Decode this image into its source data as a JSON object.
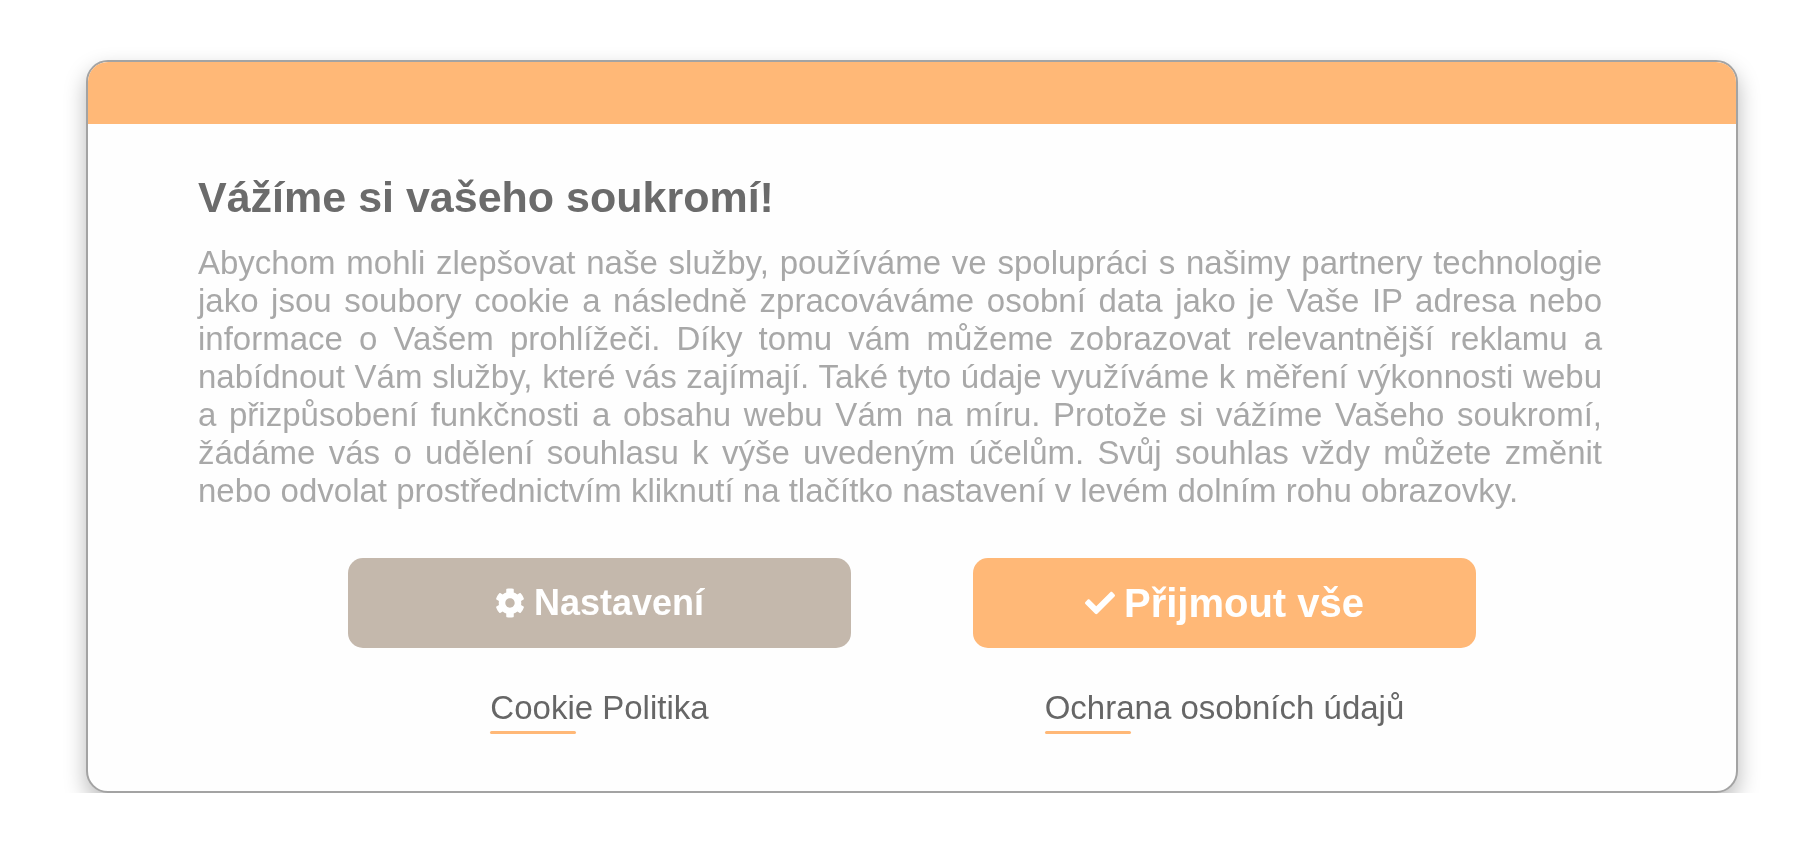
{
  "dialog": {
    "title": "Vážíme si vašeho soukromí!",
    "body": "Abychom mohli zlepšovat naše služby, používáme ve spolupráci s našimy partnery technologie jako jsou soubory cookie a následně zpracováváme osobní data jako je Vaše IP adresa nebo informace o Vašem prohlížeči. Díky tomu vám můžeme zobrazovat relevantnější reklamu a nabídnout Vám služby, které vás zajímají. Také tyto údaje využíváme k měření výkonnosti webu a přizpůsobení funkčnosti a obsahu webu Vám na míru. Protože si vážíme Vašeho soukromí, žádáme vás o udělení souhlasu k výše uvedeným účelům. Svůj souhlas vždy můžete změnit nebo odvolat prostřednictvím kliknutí na tlačítko nastavení v levém dolním rohu obrazovky.",
    "actions": [
      {
        "button": {
          "kind": "settings",
          "label": "Nastavení"
        },
        "link": "Cookie Politika"
      },
      {
        "button": {
          "kind": "accept",
          "label": "Přijmout vše"
        },
        "link": "Ochrana osobních údajů"
      }
    ]
  }
}
